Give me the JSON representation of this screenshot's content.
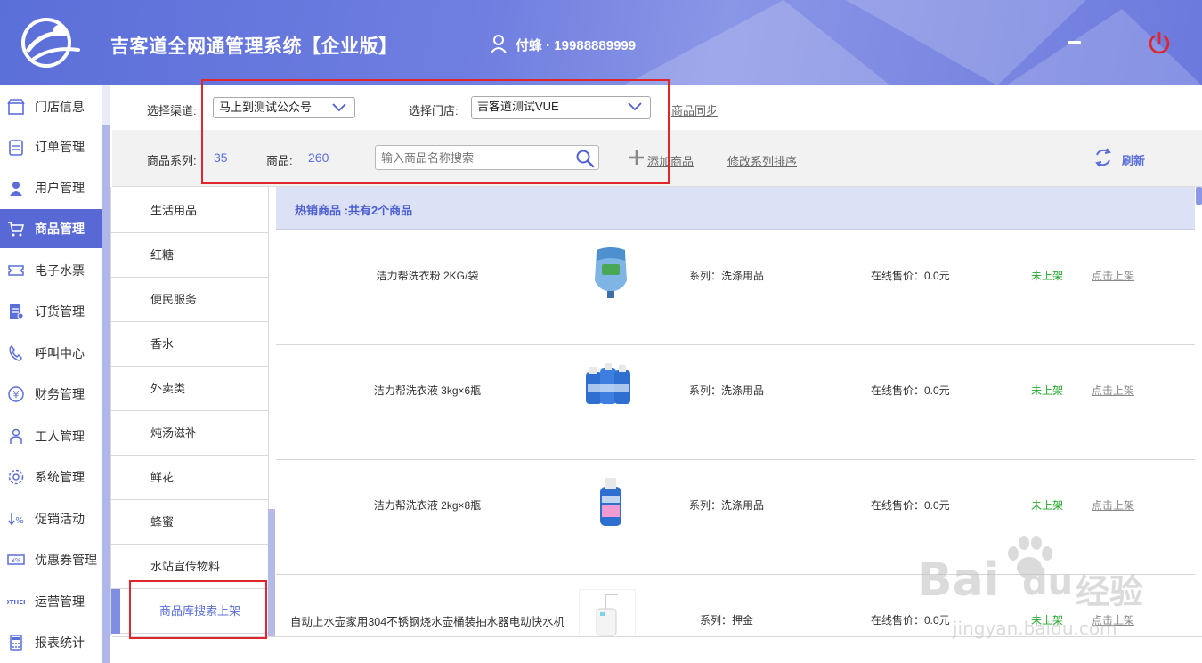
{
  "header": {
    "title": "吉客道全网通管理系统【企业版】",
    "user": "付蜂 · 19988889999"
  },
  "sidebar": {
    "items": [
      {
        "label": "门店信息",
        "icon": "store-icon"
      },
      {
        "label": "订单管理",
        "icon": "clipboard-icon"
      },
      {
        "label": "用户管理",
        "icon": "user-icon"
      },
      {
        "label": "商品管理",
        "icon": "cart-icon",
        "active": true
      },
      {
        "label": "电子水票",
        "icon": "ticket-icon"
      },
      {
        "label": "订货管理",
        "icon": "document-icon"
      },
      {
        "label": "呼叫中心",
        "icon": "phone-icon"
      },
      {
        "label": "财务管理",
        "icon": "yen-icon"
      },
      {
        "label": "工人管理",
        "icon": "worker-icon"
      },
      {
        "label": "系统管理",
        "icon": "gear-icon"
      },
      {
        "label": "促销活动",
        "icon": "percent-icon"
      },
      {
        "label": "优惠券管理",
        "icon": "coupon-icon"
      },
      {
        "label": "运营管理",
        "icon": "other-icon"
      },
      {
        "label": "报表统计",
        "icon": "calculator-icon"
      }
    ]
  },
  "toolbar": {
    "channel_label": "选择渠道:",
    "channel_value": "马上到测试公众号",
    "store_label": "选择门店:",
    "store_value": "吉客道测试VUE",
    "sync_link": "商品同步",
    "series_label": "商品系列:",
    "series_count": "35",
    "goods_label": "商品:",
    "goods_count": "260",
    "search_placeholder": "输入商品名称搜索",
    "add_goods": "添加商品",
    "reorder_series": "修改系列排序",
    "refresh": "刷新"
  },
  "categories": [
    {
      "label": "生活用品"
    },
    {
      "label": "红糖"
    },
    {
      "label": "便民服务"
    },
    {
      "label": "香水"
    },
    {
      "label": "外卖类"
    },
    {
      "label": "炖汤滋补"
    },
    {
      "label": "鲜花"
    },
    {
      "label": "蜂蜜"
    },
    {
      "label": "水站宣传物料"
    },
    {
      "label": "商品库搜索上架",
      "active": true
    }
  ],
  "content": {
    "heading": "热销商品 :共有2个商品",
    "rows": [
      {
        "name": "洁力帮洗衣粉 2KG/袋",
        "series": "系列：洗涤用品",
        "price": "在线售价：0.0元",
        "status": "未上架",
        "action": "点击上架",
        "image": "jug-image"
      },
      {
        "name": "洁力帮洗衣液 3kg×6瓶",
        "series": "系列：洗涤用品",
        "price": "在线售价：0.0元",
        "status": "未上架",
        "action": "点击上架",
        "image": "bottles-image"
      },
      {
        "name": "洁力帮洗衣液 2kg×8瓶",
        "series": "系列：洗涤用品",
        "price": "在线售价：0.0元",
        "status": "未上架",
        "action": "点击上架",
        "image": "bottle-image"
      },
      {
        "name": "自动上水壶家用304不锈钢烧水壶桶装抽水器电动快水机",
        "series": "系列：押金",
        "price": "在线售价：0.0元",
        "status": "未上架",
        "action": "点击上架",
        "image": "kettle-image"
      }
    ]
  },
  "watermark": {
    "brand": "Bai",
    "brand2": "du",
    "cn": "经验",
    "url": "jingyan.baidu.com"
  }
}
